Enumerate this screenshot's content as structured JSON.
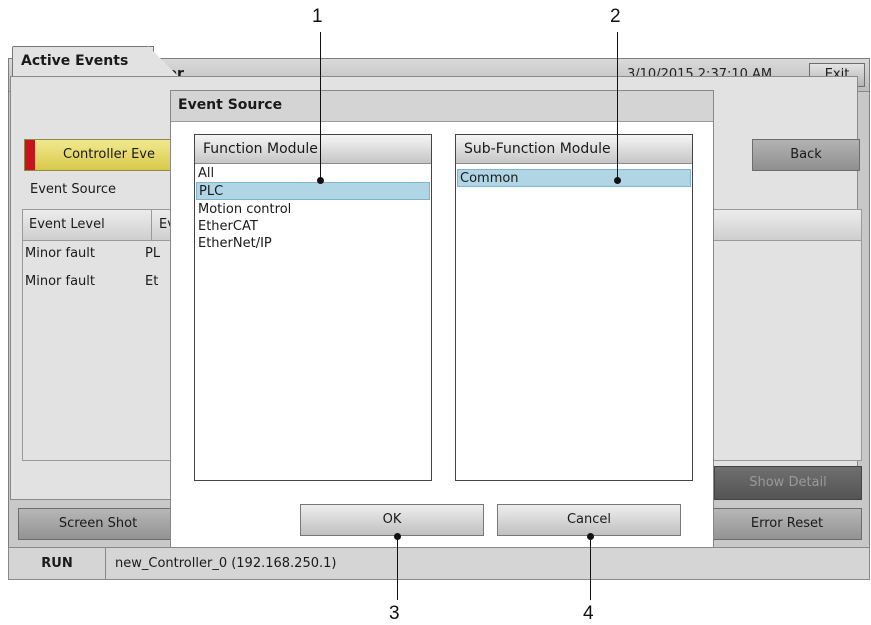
{
  "callouts": [
    "1",
    "2",
    "3",
    "4"
  ],
  "app": {
    "title": "NJ/NX Troubleshooter",
    "datetime": "3/10/2015 2:37:10 AM",
    "exit_label": "Exit"
  },
  "tabs": {
    "active_label": "Active Events"
  },
  "panel": {
    "controller_events_label": "Controller Eve",
    "back_label": "Back",
    "event_source_label": "Event Source",
    "columns": [
      "Event Level",
      "Ev"
    ],
    "rows": [
      {
        "level": "Minor fault",
        "source": "PL"
      },
      {
        "level": "Minor fault",
        "source": "Et"
      }
    ],
    "show_detail_label": "Show Detail"
  },
  "bottom_buttons": {
    "screenshot_label": "Screen Shot",
    "error_reset_label": "Error Reset"
  },
  "status": {
    "mode": "RUN",
    "connection": "new_Controller_0 (192.168.250.1)"
  },
  "dialog": {
    "title": "Event Source",
    "function_module": {
      "header": "Function Module",
      "items": [
        "All",
        "PLC",
        "Motion control",
        "EtherCAT",
        "EtherNet/IP"
      ],
      "selected": "PLC"
    },
    "sub_function_module": {
      "header": "Sub-Function Module",
      "items": [
        "Common"
      ],
      "selected": "Common"
    },
    "ok_label": "OK",
    "cancel_label": "Cancel"
  },
  "colors": {
    "selection": "#b0d6e6",
    "controller_event_yellow": "#e6dc6a",
    "controller_event_red": "#c4161c"
  }
}
